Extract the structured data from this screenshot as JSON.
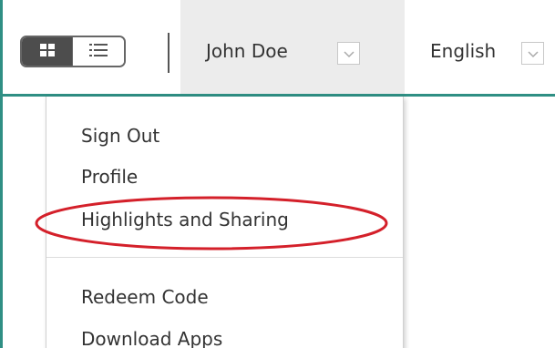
{
  "header": {
    "user_name": "John Doe",
    "language": "English"
  },
  "user_menu": {
    "items": [
      {
        "label": "Sign Out"
      },
      {
        "label": "Profile"
      },
      {
        "label": "Highlights and Sharing"
      },
      {
        "label": "Redeem Code"
      },
      {
        "label": "Download Apps"
      }
    ]
  },
  "icons": {
    "grid_view": "grid-icon",
    "list_view": "list-icon",
    "dropdown_caret": "chevron-down-icon"
  },
  "colors": {
    "accent_border": "#2f8f84",
    "annotation": "#d4202a",
    "active_toggle": "#4d4d4d",
    "tab_background": "#ececec"
  }
}
